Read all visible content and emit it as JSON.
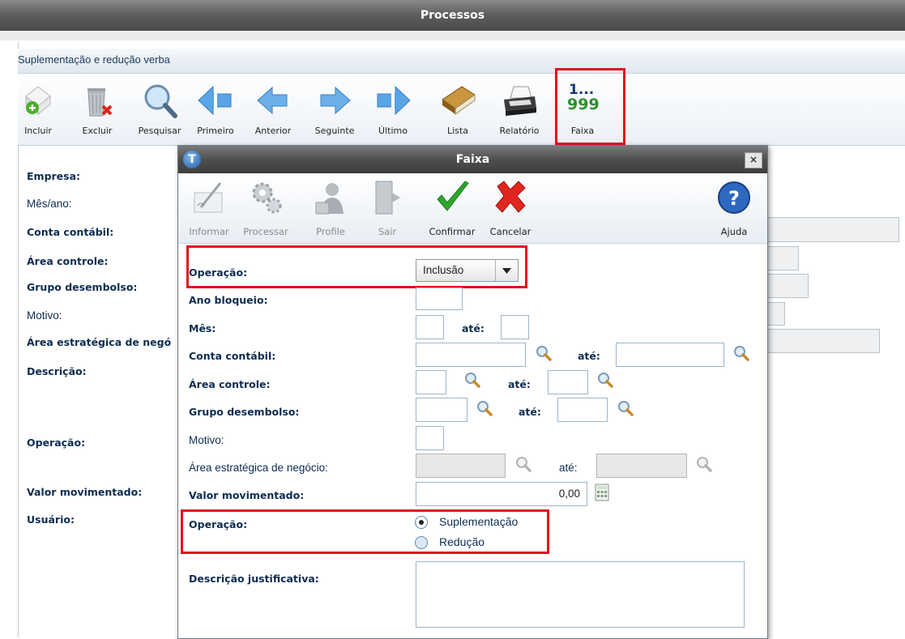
{
  "window": {
    "title": "Processos"
  },
  "module": {
    "title": "Suplementação e redução verba"
  },
  "toolbar": {
    "items": [
      {
        "label": "Incluir",
        "icon": "add-document-icon"
      },
      {
        "label": "Excluir",
        "icon": "trash-delete-icon"
      },
      {
        "label": "Pesquisar",
        "icon": "magnifier-icon"
      },
      {
        "label": "Primeiro",
        "icon": "first-arrow-icon"
      },
      {
        "label": "Anterior",
        "icon": "previous-arrow-icon"
      },
      {
        "label": "Seguinte",
        "icon": "next-arrow-icon"
      },
      {
        "label": "Último",
        "icon": "last-arrow-icon"
      },
      {
        "label": "Lista",
        "icon": "book-list-icon"
      },
      {
        "label": "Relatório",
        "icon": "printer-icon"
      },
      {
        "label": "Faixa",
        "icon": "range-1-999-icon",
        "icon_text_top": "1...",
        "icon_text_bottom": "999"
      }
    ]
  },
  "background_form": {
    "labels": {
      "empresa": "Empresa:",
      "mes_ano": "Mês/ano:",
      "conta_contabil": "Conta contábil:",
      "area_controle": "Área controle:",
      "grupo_desembolso": "Grupo desembolso:",
      "motivo": "Motivo:",
      "area_estrategica": "Área estratégica de negó",
      "descricao": "Descrição:",
      "operacao": "Operação:",
      "valor_movimentado": "Valor movimentado:",
      "usuario": "Usuário:"
    }
  },
  "dialog": {
    "title": "Faixa",
    "logo_letter": "T",
    "close_label": "×",
    "toolbar": {
      "informar": "Informar",
      "processar": "Processar",
      "profile": "Profile",
      "sair": "Sair",
      "confirmar": "Confirmar",
      "cancelar": "Cancelar",
      "ajuda": "Ajuda"
    },
    "form": {
      "operacao_label": "Operação:",
      "operacao_value": "Inclusão",
      "ano_bloqueio_label": "Ano bloqueio:",
      "mes_label": "Mês:",
      "ate_label": "até:",
      "conta_contabil_label": "Conta contábil:",
      "area_controle_label": "Área controle:",
      "grupo_desembolso_label": "Grupo desembolso:",
      "motivo_label": "Motivo:",
      "area_estrategica_label": "Área estratégica de negócio:",
      "valor_movimentado_label": "Valor movimentado:",
      "valor_movimentado_value": "0,00",
      "operacao2_label": "Operação:",
      "radio_suplementacao": "Suplementação",
      "radio_reducao": "Redução",
      "radio_selected": "Suplementação",
      "descricao_justificativa_label": "Descrição justificativa:"
    }
  },
  "colors": {
    "highlight_red": "#e0101e",
    "label_blue": "#0d2c52",
    "title_bar": "#5c5c5c"
  }
}
